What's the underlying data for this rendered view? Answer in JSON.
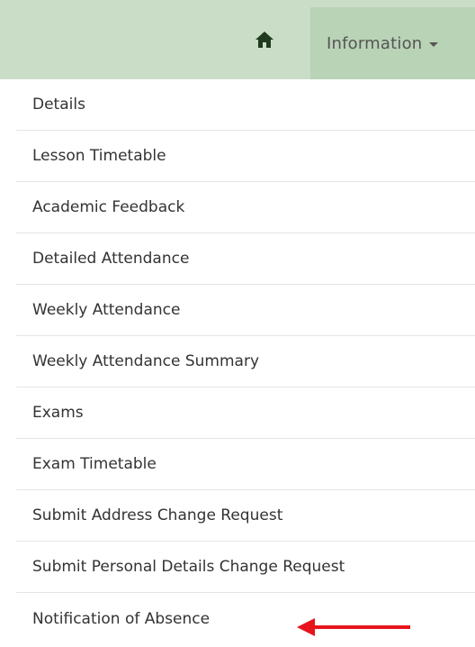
{
  "nav": {
    "home_icon": "home-icon",
    "information_label": "Information"
  },
  "menu": {
    "items": [
      {
        "label": "Details"
      },
      {
        "label": "Lesson Timetable"
      },
      {
        "label": "Academic Feedback"
      },
      {
        "label": "Detailed Attendance"
      },
      {
        "label": "Weekly Attendance"
      },
      {
        "label": "Weekly Attendance Summary"
      },
      {
        "label": "Exams"
      },
      {
        "label": "Exam Timetable"
      },
      {
        "label": "Submit Address Change Request"
      },
      {
        "label": "Submit Personal Details Change Request"
      },
      {
        "label": "Notification of Absence"
      }
    ]
  },
  "colors": {
    "topbar": "#c9ddc7",
    "active_tab": "#b8d3b5",
    "arrow": "#e8141b"
  }
}
